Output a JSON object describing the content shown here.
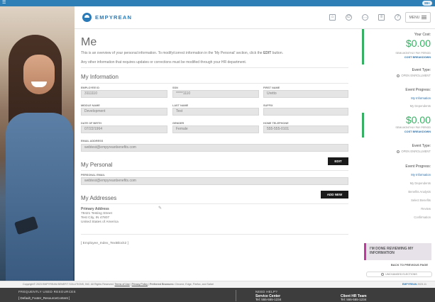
{
  "topbar": {
    "badge": "99+"
  },
  "header": {
    "brand": "EMPYREAN",
    "icons": [
      "home-icon",
      "help-circle-icon",
      "chat-icon",
      "document-icon",
      "question-icon"
    ],
    "menu_label": "MENU"
  },
  "page": {
    "title": "Me",
    "intro_line1_pre": "This is an overview of your personal information. To modify/correct information in the 'My Personal' section, click the ",
    "intro_line1_edit": "EDIT",
    "intro_line1_post": " button.",
    "intro_line2": "Any other information that requires updates or corrections must be modified through your HR department."
  },
  "my_information": {
    "title": "My Information",
    "fields": {
      "employee_id": {
        "label": "EMPLOYEE ID",
        "value": "3111110"
      },
      "ssn": {
        "label": "SSN",
        "value": "*****1110"
      },
      "first_name": {
        "label": "FIRST NAME",
        "value": "Uretto"
      },
      "middle_name": {
        "label": "MIDDLE NAME",
        "value": "Development"
      },
      "last_name": {
        "label": "LAST NAME",
        "value": "Test"
      },
      "suffix": {
        "label": "SUFFIX",
        "value": ""
      },
      "date_of_birth": {
        "label": "DATE OF BIRTH",
        "value": "07/22/1964"
      },
      "gender": {
        "label": "GENDER",
        "value": "Female"
      },
      "home_telephone": {
        "label": "HOME TELEPHONE",
        "value": "555-555-0101"
      },
      "email_address": {
        "label": "EMAIL ADDRESS",
        "value": "webtest@empyreanbenefits.com"
      }
    }
  },
  "my_personal": {
    "title": "My Personal",
    "edit_label": "EDIT",
    "personal_email_label": "PERSONAL EMAIL",
    "personal_email_value": "webtest@empyreanbenefits.com"
  },
  "my_addresses": {
    "title": "My Addresses",
    "add_new_label": "ADD NEW",
    "address_type": "Primary Address",
    "line1": "78421 Testing Street",
    "line2": "Test City, IN 47807",
    "line3": "United States of America",
    "resource_key": "[ Employee_Index_TextBlock2 ]"
  },
  "sidebar": {
    "your_cost_label": "Your Cost:",
    "cost_amount": "$0.00",
    "cost_period": "SEMI-MONTHLY PAY PERIOD",
    "cost_breakdown": "COST BREAKDOWN",
    "event_type_label": "Event Type:",
    "event_type_value": "OPEN ENROLLMENT",
    "event_progress_label": "Event Progress:",
    "progress_items_1": [
      "My Information",
      "My Dependents"
    ],
    "cost_amount_2": "$0.00",
    "cost_period_2": "SEMI-MONTHLY PAY PERIOD",
    "cost_breakdown_2": "COST BREAKDOWN",
    "event_type_label_2": "Event Type:",
    "event_type_value_2": "OPEN ENROLLMENT",
    "event_progress_label_2": "Event Progress:",
    "progress_items_2": [
      "My Information",
      "My Dependents",
      "Benefits Analysis",
      "Select Benefits",
      "Review",
      "Confirmation"
    ],
    "done_button": "I'M DONE REVIEWING MY INFORMATION",
    "back_link": "BACK TO PREVIOUS PAGE",
    "unchanged_elections": "UNCHANGED ELECTIONS"
  },
  "copyright": {
    "text": "Copyright© 2023 EMPYREAN BENEFIT SOLUTIONS, INC. All Rights Reserved.",
    "terms": "Terms of Use",
    "privacy": "Privacy Policy",
    "browsers_label": "Preferred Browsers:",
    "browsers": "Chrome, Edge, Firefox, and Safari",
    "version_brand": "EMPYREAN",
    "version": "2023.11"
  },
  "footer": {
    "frequent_title": "FREQUENTLY USED RESOURCES",
    "frequent_content": "[ Default_Footer_ResourceContent ]",
    "help_title": "NEED HELP?",
    "service_center_label": "Service Center",
    "service_center_tel": "Tel: 555-555-1234",
    "client_hr_label": "Client HR Team",
    "client_hr_tel": "Tel: 555-555-1234"
  },
  "colors": {
    "accent_blue": "#2a7ab8",
    "money_green": "#36b062",
    "done_magenta": "#c0399f"
  }
}
